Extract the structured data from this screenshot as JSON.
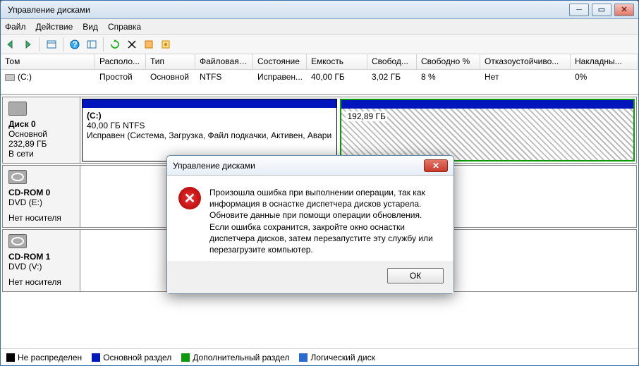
{
  "window": {
    "title": "Управление дисками"
  },
  "menu": {
    "file": "Файл",
    "action": "Действие",
    "view": "Вид",
    "help": "Справка"
  },
  "columns": {
    "volume": "Том",
    "layout": "Располо...",
    "type": "Тип",
    "filesys": "Файловая с...",
    "status": "Состояние",
    "capacity": "Емкость",
    "free": "Свобод...",
    "freepct": "Свободно %",
    "fault": "Отказоустойчиво...",
    "overhead": "Накладны..."
  },
  "vol": {
    "name": "(C:)",
    "layout": "Простой",
    "type": "Основной",
    "fs": "NTFS",
    "status": "Исправен...",
    "cap": "40,00 ГБ",
    "free": "3,02 ГБ",
    "freepct": "8 %",
    "fault": "Нет",
    "ovh": "0%"
  },
  "disk0": {
    "name": "Диск 0",
    "type": "Основной",
    "size": "232,89 ГБ",
    "state": "В сети",
    "p1_label": "(C:)",
    "p1_size": "40,00 ГБ NTFS",
    "p1_status": "Исправен (Система, Загрузка, Файл подкачки, Активен, Авари",
    "p2_size": "192,89 ГБ"
  },
  "cd0": {
    "name": "CD-ROM 0",
    "dev": "DVD (E:)",
    "state": "Нет носителя"
  },
  "cd1": {
    "name": "CD-ROM 1",
    "dev": "DVD (V:)",
    "state": "Нет носителя"
  },
  "legend": {
    "unalloc": "Не распределен",
    "primary": "Основной раздел",
    "extended": "Дополнительный раздел",
    "logical": "Логический диск"
  },
  "dialog": {
    "title": "Управление дисками",
    "message": "Произошла ошибка при выполнении операции, так как информация в оснастке диспетчера дисков устарела. Обновите данные при помощи операции обновления.  Если ошибка сохранится, закройте окно оснастки диспетчера дисков, затем перезапустите эту службу или перезагрузите компьютер.",
    "ok": "ОК"
  }
}
